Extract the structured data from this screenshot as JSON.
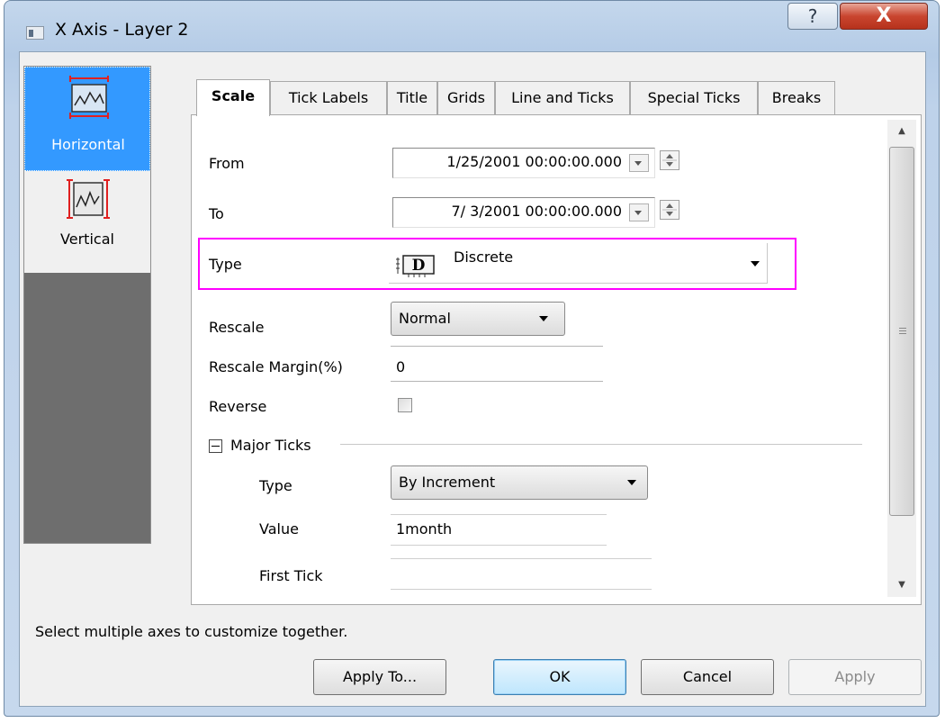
{
  "window": {
    "title": "X Axis - Layer 2",
    "help_label": "?",
    "close_label": "X"
  },
  "side": {
    "items": [
      {
        "label": "Horizontal",
        "icon": "horizontal-axis-icon",
        "selected": true
      },
      {
        "label": "Vertical",
        "icon": "vertical-axis-icon",
        "selected": false
      }
    ]
  },
  "tabs": [
    "Scale",
    "Tick Labels",
    "Title",
    "Grids",
    "Line and Ticks",
    "Special Ticks",
    "Breaks"
  ],
  "active_tab": "Scale",
  "form": {
    "from_label": "From",
    "from_value": "1/25/2001 00:00:00.000",
    "to_label": "To",
    "to_value": "7/ 3/2001 00:00:00.000",
    "type_label": "Type",
    "type_value": "Discrete",
    "type_icon_letter": "D",
    "rescale_label": "Rescale",
    "rescale_value": "Normal",
    "rescale_margin_label": "Rescale Margin(%)",
    "rescale_margin_value": "0",
    "reverse_label": "Reverse",
    "reverse_checked": false,
    "major_ticks_toggle": "⊟",
    "major_ticks_label": "Major Ticks",
    "major_type_label": "Type",
    "major_type_value": "By Increment",
    "value_label": "Value",
    "value_value": "1month",
    "first_tick_label": "First Tick",
    "first_tick_value": ""
  },
  "status_text": "Select multiple axes to customize together.",
  "buttons": {
    "apply_to": "Apply To...",
    "ok": "OK",
    "cancel": "Cancel",
    "apply": "Apply"
  },
  "colors": {
    "selection": "#3399ff",
    "highlight": "#ff00ff",
    "side_background": "#6e6e6e"
  }
}
